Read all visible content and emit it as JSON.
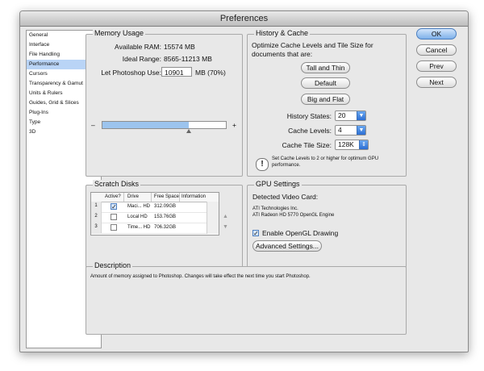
{
  "window": {
    "title": "Preferences"
  },
  "sidebar": {
    "items": [
      {
        "label": "General",
        "selected": false
      },
      {
        "label": "Interface",
        "selected": false
      },
      {
        "label": "File Handling",
        "selected": false
      },
      {
        "label": "Performance",
        "selected": true
      },
      {
        "label": "Cursors",
        "selected": false
      },
      {
        "label": "Transparency & Gamut",
        "selected": false
      },
      {
        "label": "Units & Rulers",
        "selected": false
      },
      {
        "label": "Guides, Grid & Slices",
        "selected": false
      },
      {
        "label": "Plug-Ins",
        "selected": false
      },
      {
        "label": "Type",
        "selected": false
      },
      {
        "label": "3D",
        "selected": false
      }
    ]
  },
  "memory": {
    "title": "Memory Usage",
    "available_label": "Available RAM:",
    "available_value": "15574 MB",
    "ideal_label": "Ideal Range:",
    "ideal_value": "8565-11213 MB",
    "let_label": "Let Photoshop Use:",
    "let_value": "10901",
    "let_unit": "MB (70%)",
    "slider_min": "–",
    "slider_max": "+",
    "slider_fraction": 0.7
  },
  "history": {
    "title": "History & Cache",
    "optimize_text_1": "Optimize Cache Levels and Tile Size for",
    "optimize_text_2": "documents that are:",
    "btn_tall": "Tall and Thin",
    "btn_default": "Default",
    "btn_big": "Big and Flat",
    "states_label": "History States:",
    "states_value": "20",
    "levels_label": "Cache Levels:",
    "levels_value": "4",
    "tile_label": "Cache Tile Size:",
    "tile_value": "128K",
    "note_1": "Set Cache Levels to 2 or higher for optimum GPU",
    "note_2": "performance."
  },
  "scratch": {
    "title": "Scratch Disks",
    "columns": [
      "Active?",
      "Drive",
      "Free Space",
      "Information"
    ],
    "rows": [
      {
        "num": "1",
        "active": true,
        "drive": "Maci... HD",
        "free": "312.09GB"
      },
      {
        "num": "2",
        "active": false,
        "drive": "Local HD",
        "free": "153.76GB"
      },
      {
        "num": "3",
        "active": false,
        "drive": "Time... HD",
        "free": "706.32GB"
      }
    ],
    "up_arrow": "▲",
    "down_arrow": "▼"
  },
  "gpu": {
    "title": "GPU Settings",
    "detected_label": "Detected Video Card:",
    "vendor": "ATI Technologies Inc.",
    "card": "ATI Radeon HD 5770 OpenGL Engine",
    "opengl_label": "Enable OpenGL Drawing",
    "opengl_checked": true,
    "advanced_label": "Advanced Settings..."
  },
  "description": {
    "title": "Description",
    "text": "Amount of memory assigned to Photoshop. Changes will take effect the next time you start Photoshop."
  },
  "buttons": {
    "ok": "OK",
    "cancel": "Cancel",
    "prev": "Prev",
    "next": "Next"
  },
  "icons": {
    "check": "✓",
    "warning": "!",
    "dropdown": "▼",
    "stepper": "⇕"
  }
}
